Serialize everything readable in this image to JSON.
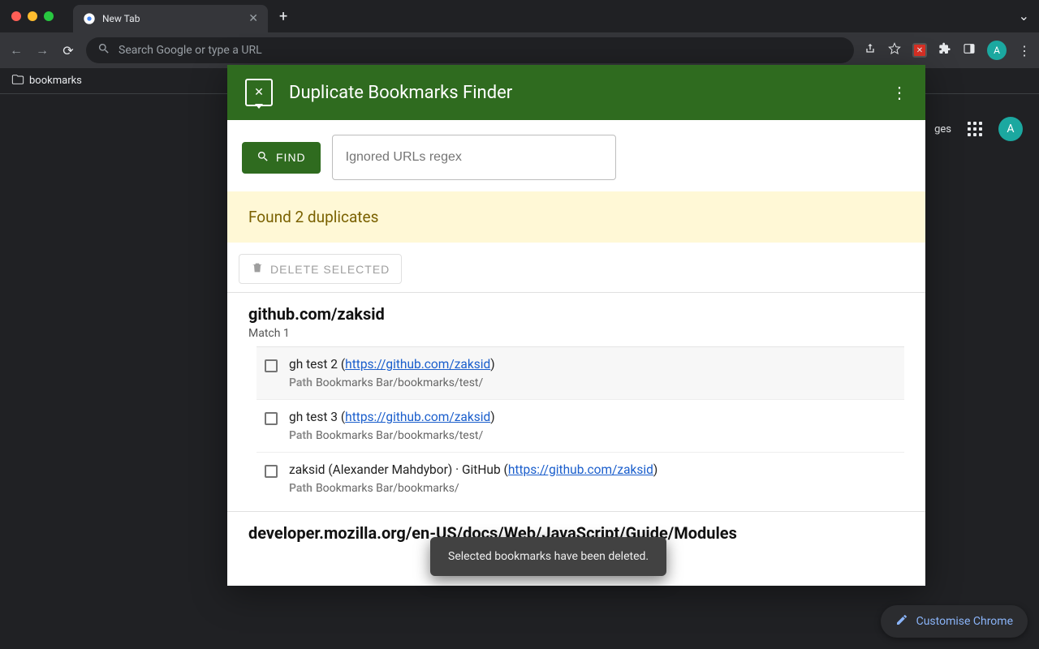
{
  "browser": {
    "tab_title": "New Tab",
    "omnibox_placeholder": "Search Google or type a URL",
    "bookmarks_bar_label": "bookmarks",
    "avatar_letter": "A",
    "ntp_images_label": "ges",
    "customise_label": "Customise Chrome"
  },
  "extension": {
    "title": "Duplicate Bookmarks Finder",
    "find_button": "FIND",
    "regex_placeholder": "Ignored URLs regex",
    "result_banner": "Found 2 duplicates",
    "delete_button": "DELETE SELECTED",
    "toast": "Selected bookmarks have been deleted.",
    "groups": [
      {
        "title": "github.com/zaksid",
        "subtitle": "Match 1",
        "entries": [
          {
            "label_pre": "gh test 2 (",
            "url": "https://github.com/zaksid",
            "label_post": ")",
            "path_label": "Path",
            "path": "Bookmarks Bar/bookmarks/test/",
            "alt": true
          },
          {
            "label_pre": "gh test 3 (",
            "url": "https://github.com/zaksid",
            "label_post": ")",
            "path_label": "Path",
            "path": "Bookmarks Bar/bookmarks/test/",
            "alt": false
          },
          {
            "label_pre": "zaksid (Alexander Mahdybor) · GitHub (",
            "url": "https://github.com/zaksid",
            "label_post": ")",
            "path_label": "Path",
            "path": "Bookmarks Bar/bookmarks/",
            "alt": false
          }
        ]
      },
      {
        "title": "developer.mozilla.org/en-US/docs/Web/JavaScript/Guide/Modules"
      }
    ]
  }
}
